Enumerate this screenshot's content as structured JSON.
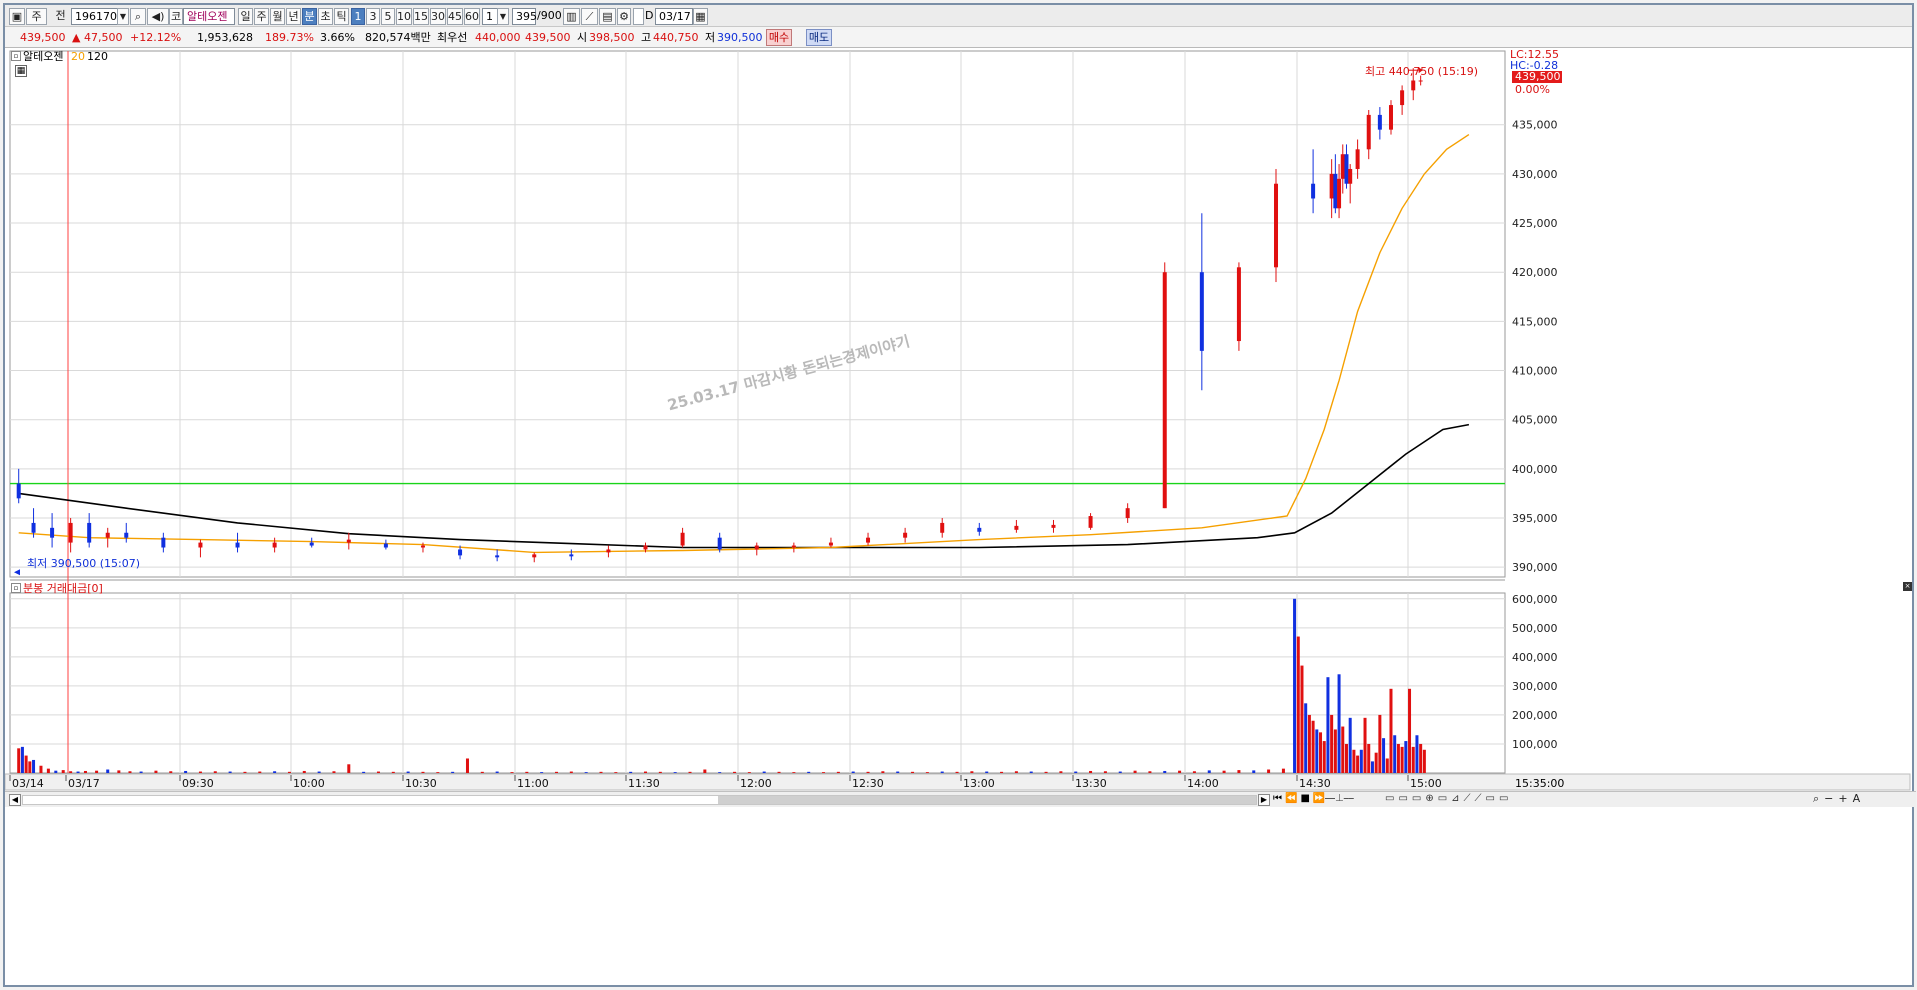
{
  "toolbar": {
    "period_button": "주",
    "prev_label": "전",
    "code_value": "196170",
    "market_label": "코",
    "stock_name": "알테오젠",
    "period_tabs": [
      "일",
      "주",
      "월",
      "년",
      "분",
      "초",
      "틱"
    ],
    "selected_period": "분",
    "intervals": [
      "1",
      "3",
      "5",
      "10",
      "15",
      "30",
      "45",
      "60"
    ],
    "selected_interval": "1",
    "interval_select": "1",
    "count_value": "395",
    "count_total": "/900",
    "d_label": "D",
    "date_value": "03/17"
  },
  "quote": {
    "price": "439,500",
    "change": "▲ 47,500",
    "change_pct": "+12.12%",
    "volume": "1,953,628",
    "volume_ratio": "189.73%",
    "turnover": "3.66%",
    "trade_value": "820,574백만",
    "ask_label": "최우선",
    "ask": "440,000",
    "bid": "439,500",
    "open_label": "시",
    "open": "398,500",
    "high_label": "고",
    "high": "440,750",
    "low_label": "저",
    "low": "390,500",
    "buy_button": "매수",
    "sell_button": "매도"
  },
  "price_panel": {
    "title": "알테오젠",
    "ma_short": "20",
    "ma_long": "120",
    "watermark": "25.03.17 마감시황 돈되는경제이야기",
    "high_annot": "최고 440,750 (15:19)",
    "low_annot": "최저 390,500 (15:07)",
    "lc": "LC:12.55",
    "hc": "HC:-0.28",
    "current_tag": "439,500",
    "current_pct": "0.00%"
  },
  "volume_panel": {
    "title": "분봉 거래대금[0]"
  },
  "time_axis": {
    "labels": [
      "03/14",
      "03/17",
      "09:30",
      "10:00",
      "10:30",
      "11:00",
      "11:30",
      "12:00",
      "12:30",
      "13:00",
      "13:30",
      "14:00",
      "14:30",
      "15:00"
    ],
    "end_time": "15:35:00"
  },
  "chart_data": [
    {
      "type": "candlestick",
      "title": "알테오젠",
      "series_names": [
        "20",
        "120"
      ],
      "y_ticks": [
        "435,000",
        "430,000",
        "425,000",
        "420,000",
        "415,000",
        "410,000",
        "405,000",
        "400,000",
        "395,000",
        "390,000"
      ],
      "y_tick_values": [
        435000,
        430000,
        425000,
        420000,
        415000,
        410000,
        405000,
        400000,
        395000,
        390000
      ],
      "ylim": [
        389000,
        442500
      ],
      "x_range_minutes": [
        540,
        935
      ],
      "support_line": 398500,
      "candles_bar_minutes": [
        541,
        545,
        550,
        555,
        560,
        565,
        570,
        580,
        590,
        600,
        610,
        620,
        630,
        640,
        650,
        660,
        670,
        680,
        690,
        700,
        710,
        720,
        730,
        740,
        750,
        760,
        770,
        780,
        790,
        800,
        810,
        820,
        830,
        840,
        850,
        860,
        870,
        880,
        890,
        895,
        896,
        897,
        898,
        899,
        900,
        902,
        905,
        908,
        911,
        914,
        917,
        919
      ],
      "candles": [
        {
          "o": 398500,
          "h": 400000,
          "l": 396500,
          "c": 397000
        },
        {
          "o": 394500,
          "h": 396000,
          "l": 393000,
          "c": 393500
        },
        {
          "o": 394000,
          "h": 395500,
          "l": 392000,
          "c": 393000
        },
        {
          "o": 392500,
          "h": 395000,
          "l": 391500,
          "c": 394500
        },
        {
          "o": 394500,
          "h": 395500,
          "l": 392000,
          "c": 392500
        },
        {
          "o": 393000,
          "h": 394000,
          "l": 392000,
          "c": 393500
        },
        {
          "o": 393500,
          "h": 394500,
          "l": 392500,
          "c": 393000
        },
        {
          "o": 393000,
          "h": 393500,
          "l": 391500,
          "c": 392000
        },
        {
          "o": 392000,
          "h": 392800,
          "l": 391000,
          "c": 392500
        },
        {
          "o": 392500,
          "h": 393500,
          "l": 391500,
          "c": 392000
        },
        {
          "o": 392000,
          "h": 393000,
          "l": 391500,
          "c": 392500
        },
        {
          "o": 392500,
          "h": 393000,
          "l": 392000,
          "c": 392200
        },
        {
          "o": 392500,
          "h": 393500,
          "l": 391800,
          "c": 392800
        },
        {
          "o": 392400,
          "h": 392800,
          "l": 391800,
          "c": 392000
        },
        {
          "o": 392000,
          "h": 392500,
          "l": 391500,
          "c": 392200
        },
        {
          "o": 391800,
          "h": 392200,
          "l": 390800,
          "c": 391200
        },
        {
          "o": 391200,
          "h": 391800,
          "l": 390600,
          "c": 391000
        },
        {
          "o": 391000,
          "h": 391500,
          "l": 390500,
          "c": 391300
        },
        {
          "o": 391300,
          "h": 391800,
          "l": 390700,
          "c": 391100
        },
        {
          "o": 391500,
          "h": 392200,
          "l": 391000,
          "c": 391800
        },
        {
          "o": 391800,
          "h": 392500,
          "l": 391500,
          "c": 392200
        },
        {
          "o": 392200,
          "h": 394000,
          "l": 392000,
          "c": 393500
        },
        {
          "o": 393000,
          "h": 393500,
          "l": 391500,
          "c": 391800
        },
        {
          "o": 391800,
          "h": 392500,
          "l": 391200,
          "c": 392200
        },
        {
          "o": 392000,
          "h": 392500,
          "l": 391500,
          "c": 392200
        },
        {
          "o": 392200,
          "h": 393000,
          "l": 392000,
          "c": 392500
        },
        {
          "o": 392500,
          "h": 393500,
          "l": 392200,
          "c": 393000
        },
        {
          "o": 393000,
          "h": 394000,
          "l": 392500,
          "c": 393500
        },
        {
          "o": 393500,
          "h": 395000,
          "l": 393000,
          "c": 394500
        },
        {
          "o": 394000,
          "h": 394500,
          "l": 393200,
          "c": 393600
        },
        {
          "o": 393800,
          "h": 394800,
          "l": 393500,
          "c": 394200
        },
        {
          "o": 394000,
          "h": 394800,
          "l": 393500,
          "c": 394300
        },
        {
          "o": 394000,
          "h": 395500,
          "l": 393800,
          "c": 395200
        },
        {
          "o": 395000,
          "h": 396500,
          "l": 394500,
          "c": 396000
        },
        {
          "o": 396000,
          "h": 421000,
          "l": 396000,
          "c": 420000
        },
        {
          "o": 420000,
          "h": 426000,
          "l": 408000,
          "c": 412000
        },
        {
          "o": 413000,
          "h": 421000,
          "l": 412000,
          "c": 420500
        },
        {
          "o": 420500,
          "h": 430500,
          "l": 419000,
          "c": 429000
        },
        {
          "o": 429000,
          "h": 432500,
          "l": 426000,
          "c": 427500
        },
        {
          "o": 427500,
          "h": 431500,
          "l": 425500,
          "c": 430000
        },
        {
          "o": 430000,
          "h": 432000,
          "l": 426000,
          "c": 426500
        },
        {
          "o": 426500,
          "h": 431000,
          "l": 425500,
          "c": 429500
        },
        {
          "o": 429500,
          "h": 433000,
          "l": 428000,
          "c": 432000
        },
        {
          "o": 432000,
          "h": 433000,
          "l": 428500,
          "c": 429000
        },
        {
          "o": 429000,
          "h": 431000,
          "l": 427000,
          "c": 430500
        },
        {
          "o": 430500,
          "h": 433500,
          "l": 429500,
          "c": 432500
        },
        {
          "o": 432500,
          "h": 436500,
          "l": 431500,
          "c": 436000
        },
        {
          "o": 436000,
          "h": 436800,
          "l": 433500,
          "c": 434500
        },
        {
          "o": 434500,
          "h": 437500,
          "l": 434000,
          "c": 437000
        },
        {
          "o": 437000,
          "h": 439000,
          "l": 436000,
          "c": 438500
        },
        {
          "o": 438500,
          "h": 440750,
          "l": 437500,
          "c": 439500
        },
        {
          "o": 439500,
          "h": 440000,
          "l": 439000,
          "c": 439500
        }
      ],
      "ma20": [
        [
          541,
          393500
        ],
        [
          560,
          393000
        ],
        [
          590,
          392800
        ],
        [
          620,
          392600
        ],
        [
          650,
          392300
        ],
        [
          680,
          391500
        ],
        [
          720,
          391700
        ],
        [
          760,
          392000
        ],
        [
          800,
          392800
        ],
        [
          830,
          393300
        ],
        [
          860,
          394000
        ],
        [
          883,
          395200
        ],
        [
          888,
          399000
        ],
        [
          893,
          404000
        ],
        [
          897,
          409000
        ],
        [
          902,
          416000
        ],
        [
          908,
          422000
        ],
        [
          914,
          426500
        ],
        [
          920,
          430000
        ],
        [
          926,
          432500
        ],
        [
          932,
          434000
        ]
      ],
      "ma120": [
        [
          541,
          397500
        ],
        [
          570,
          396000
        ],
        [
          600,
          394500
        ],
        [
          630,
          393400
        ],
        [
          660,
          392800
        ],
        [
          690,
          392400
        ],
        [
          720,
          392000
        ],
        [
          760,
          392000
        ],
        [
          800,
          392000
        ],
        [
          840,
          392300
        ],
        [
          875,
          393000
        ],
        [
          885,
          393500
        ],
        [
          895,
          395500
        ],
        [
          905,
          398500
        ],
        [
          915,
          401500
        ],
        [
          925,
          404000
        ],
        [
          932,
          404500
        ]
      ]
    },
    {
      "type": "bar",
      "title": "분봉 거래대금[0]",
      "y_ticks": [
        "600,000",
        "500,000",
        "400,000",
        "300,000",
        "200,000",
        "100,000"
      ],
      "y_tick_values": [
        600000,
        500000,
        400000,
        300000,
        200000,
        100000
      ],
      "ylim": [
        0,
        620000
      ],
      "x_minutes": [
        541,
        542,
        543,
        544,
        545,
        547,
        549,
        551,
        553,
        555,
        557,
        559,
        562,
        565,
        568,
        571,
        574,
        578,
        582,
        586,
        590,
        594,
        598,
        602,
        606,
        610,
        614,
        618,
        622,
        626,
        630,
        634,
        638,
        642,
        646,
        650,
        654,
        658,
        662,
        666,
        670,
        674,
        678,
        682,
        686,
        690,
        694,
        698,
        702,
        706,
        710,
        714,
        718,
        722,
        726,
        730,
        734,
        738,
        742,
        746,
        750,
        754,
        758,
        762,
        766,
        770,
        774,
        778,
        782,
        786,
        790,
        794,
        798,
        802,
        806,
        810,
        814,
        818,
        822,
        826,
        830,
        834,
        838,
        842,
        846,
        850,
        854,
        858,
        862,
        866,
        870,
        874,
        878,
        882,
        885,
        886,
        887,
        888,
        889,
        890,
        891,
        892,
        893,
        894,
        895,
        896,
        897,
        898,
        899,
        900,
        901,
        902,
        903,
        904,
        905,
        906,
        907,
        908,
        909,
        910,
        911,
        912,
        913,
        914,
        915,
        916,
        917,
        918,
        919,
        920
      ],
      "values": [
        85000,
        90000,
        60000,
        40000,
        45000,
        25000,
        15000,
        8000,
        10000,
        6000,
        5000,
        7000,
        8000,
        12000,
        9000,
        6000,
        5000,
        8000,
        6000,
        7000,
        5000,
        6000,
        5000,
        4000,
        5000,
        6000,
        4000,
        7000,
        5000,
        6000,
        30000,
        4000,
        5000,
        4000,
        5000,
        4000,
        3000,
        4000,
        50000,
        4000,
        5000,
        3000,
        4000,
        3000,
        4000,
        5000,
        3000,
        4000,
        3000,
        4000,
        5000,
        4000,
        3000,
        4000,
        12000,
        3000,
        4000,
        3000,
        5000,
        4000,
        3000,
        4000,
        3000,
        4000,
        5000,
        4000,
        6000,
        5000,
        4000,
        3000,
        5000,
        4000,
        6000,
        5000,
        4000,
        6000,
        5000,
        4000,
        6000,
        5000,
        7000,
        6000,
        5000,
        8000,
        6000,
        7000,
        8000,
        6000,
        9000,
        8000,
        10000,
        9000,
        12000,
        15000,
        600000,
        470000,
        370000,
        240000,
        200000,
        180000,
        150000,
        140000,
        110000,
        330000,
        200000,
        150000,
        340000,
        160000,
        100000,
        190000,
        80000,
        60000,
        80000,
        190000,
        100000,
        40000,
        70000,
        200000,
        120000,
        50000,
        290000,
        130000,
        100000,
        90000,
        110000,
        290000,
        90000,
        130000,
        100000,
        80000,
        120000,
        140000,
        290000,
        300000
      ]
    }
  ],
  "colors": {
    "up": "#e01010",
    "down": "#1030e0",
    "ma20": "#f5a000",
    "ma120": "#000000",
    "support": "#19d419",
    "cursor": "#ff4040",
    "grid": "#d9d9d9"
  }
}
